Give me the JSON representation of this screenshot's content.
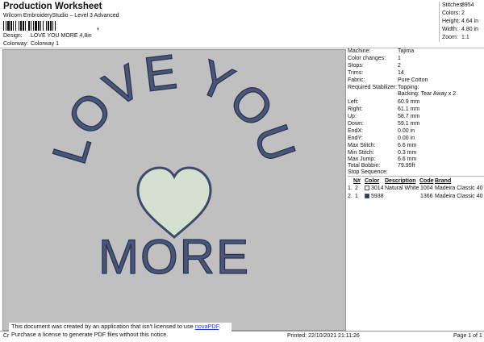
{
  "header": {
    "title": "Production Worksheet",
    "subtitle": "Wilcom EmbroideryStudio – Level 3 Advanced",
    "barcode_tail": ","
  },
  "meta": {
    "design_label": "Design:",
    "design_value": "LOVE YOU MORE 4,8in",
    "colorway_label": "Colorway:",
    "colorway_value": "Colorway 1"
  },
  "summary": [
    {
      "label": "Stitches:",
      "value": "8954"
    },
    {
      "label": "Colors:",
      "value": "2"
    },
    {
      "label": "Height:",
      "value": "4.64 in"
    },
    {
      "label": "Width:",
      "value": "4.80 in"
    },
    {
      "label": "Zoom:",
      "value": "1:1"
    }
  ],
  "design": {
    "line1": "LOVE YOU",
    "line2": "MORE",
    "text_color": "#4a5677",
    "text_edge": "#2a3350",
    "heart_fill": "#d4e0d0",
    "heart_stroke": "#3d4a6a",
    "canvas_color": "#c0c0c0"
  },
  "properties": [
    {
      "label": "Machine:",
      "value": "Tajima"
    },
    {
      "label": "Color changes:",
      "value": "1"
    },
    {
      "label": "Stops:",
      "value": "2"
    },
    {
      "label": "Trims:",
      "value": "14"
    },
    {
      "label": "Fabric:",
      "value": "Pure Cotton"
    },
    {
      "label": "Required Stabilizer:",
      "value": "Topping:"
    },
    {
      "label": "",
      "value": "Backing: Tear Away x 2"
    },
    {
      "label": "Left:",
      "value": "60.9 mm"
    },
    {
      "label": "Right:",
      "value": "61.1 mm"
    },
    {
      "label": "Up:",
      "value": "58.7 mm"
    },
    {
      "label": "Down:",
      "value": "59.1 mm"
    },
    {
      "label": "EndX:",
      "value": "0.00 in"
    },
    {
      "label": "EndY:",
      "value": "0.00 in"
    },
    {
      "label": "Max Stitch:",
      "value": "6.6 mm"
    },
    {
      "label": "Min Stitch:",
      "value": "0.3 mm"
    },
    {
      "label": "Max Jump:",
      "value": "6.6 mm"
    },
    {
      "label": "Total Bobbin:",
      "value": "79.95ft"
    }
  ],
  "stops": {
    "title": "Stop Sequence:",
    "headers": [
      "N#",
      "Color",
      "Description",
      "Code",
      "Brand"
    ],
    "rows": [
      {
        "stop": "1.",
        "n": "2",
        "color": "3014",
        "description": "Natural White",
        "code": "1004",
        "brand": "Madeira Classic 40",
        "swatch": "#f4f4ee"
      },
      {
        "stop": "2.",
        "n": "1",
        "color": "5938",
        "description": "",
        "code": "1366",
        "brand": "Madeira Classic 40",
        "swatch": "#2f3a66"
      }
    ]
  },
  "footer": {
    "cr": "Cr",
    "printed": "Printed: 22/10/2021 21:11:26",
    "page": "Page 1 of 1"
  },
  "notice": {
    "line1_prefix": "This document was created by an application that isn't licensed to use ",
    "link": "novaPDF",
    "line1_suffix": ".",
    "line2": "Purchase a license to generate PDF files without this notice."
  }
}
